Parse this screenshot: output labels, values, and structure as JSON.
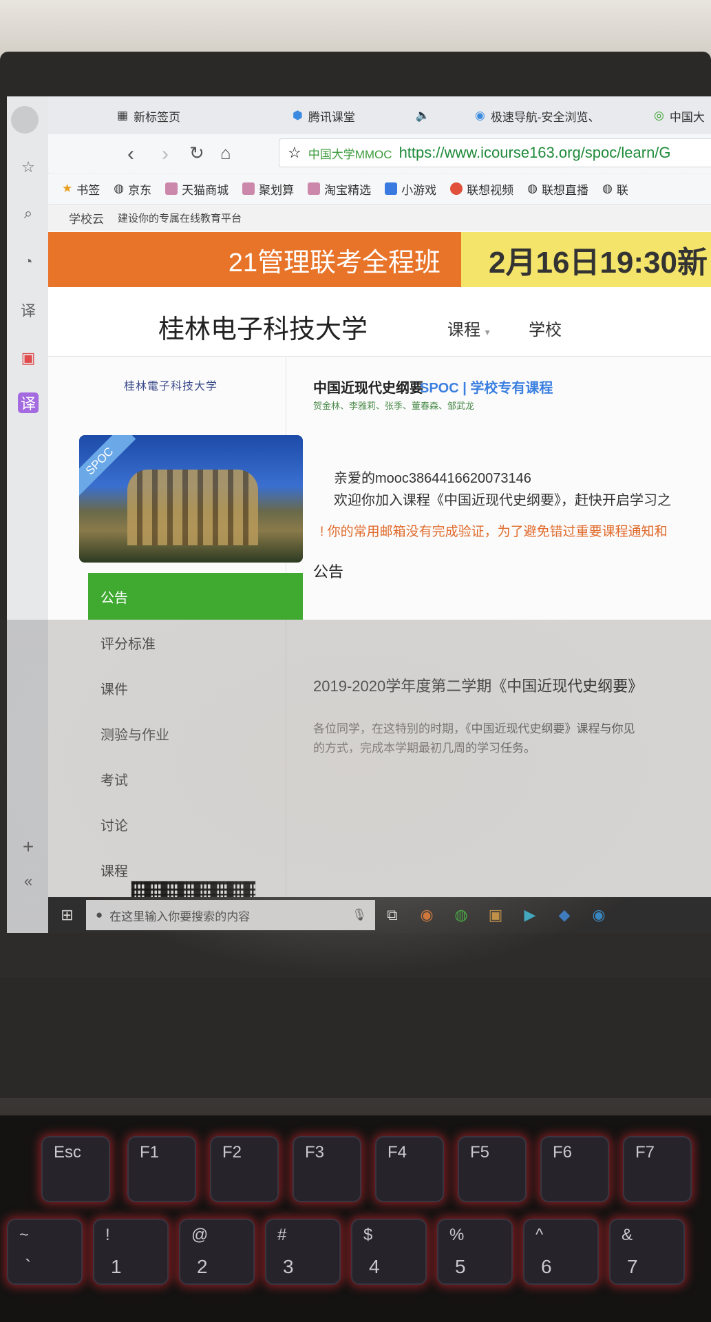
{
  "browser": {
    "tabs": [
      {
        "label": "新标签页"
      },
      {
        "label": "腾讯课堂"
      },
      {
        "label": "极速导航-安全浏览、"
      },
      {
        "label": "中国大"
      }
    ],
    "url_site": "中国大学MMOC",
    "url": "https://www.icourse163.org/spoc/learn/G",
    "bookmarks": [
      "书签",
      "京东",
      "天猫商城",
      "聚划算",
      "淘宝精选",
      "小游戏",
      "联想视频",
      "联想直播",
      "联"
    ]
  },
  "site": {
    "topline_brand": "学校云",
    "topline_slogan": "建设你的专属在线教育平台",
    "banner_left": "21管理联考全程班",
    "banner_right": "2月16日19:30新",
    "school_name": "桂林电子科技大学",
    "menu": [
      "课程",
      "学校"
    ]
  },
  "course": {
    "uni_logo_text": "桂林電子科技大学",
    "ribbon": "SPOC",
    "title": "中国近现代史纲要",
    "type": "SPOC | 学校专有课程",
    "teachers": "贺金林、李雅莉、张季、董春森、邹武龙",
    "sidebar": [
      "公告",
      "评分标准",
      "课件",
      "测验与作业",
      "考试",
      "讨论",
      "课程"
    ],
    "greeting_name": "亲爱的mooc3864416620073146",
    "greeting_text": "欢迎你加入课程《中国近现代史纲要》，赶快开启学习之",
    "warning": "你的常用邮箱没有完成验证，为了避免错过重要课程通知和",
    "notice_heading": "公告",
    "post_title": "2019-2020学年度第二学期《中国近现代史纲要》",
    "post_body_1": "各位同学，在这特别的时期，《中国近现代史纲要》课程与你见",
    "post_body_2": "的方式，完成本学期最初几周的学习任务。"
  },
  "taskbar": {
    "search_placeholder": "在这里输入你要搜索的内容"
  },
  "keyboard": {
    "fn_row": [
      "Esc",
      "F1",
      "F2",
      "F3",
      "F4",
      "F5",
      "F6",
      "F7"
    ],
    "num_row_top": [
      "~",
      "!",
      "@",
      "#",
      "$",
      "%",
      "^",
      "&"
    ],
    "num_row_bottom": [
      "`",
      "1",
      "2",
      "3",
      "4",
      "5",
      "6",
      "7"
    ]
  },
  "colors": {
    "active_nav": "#3fa930",
    "spoc_blue": "#3b7fe0",
    "banner_orange": "#e8742a",
    "banner_yellow": "#f5e46a",
    "warning_orange": "#e06a2a"
  }
}
